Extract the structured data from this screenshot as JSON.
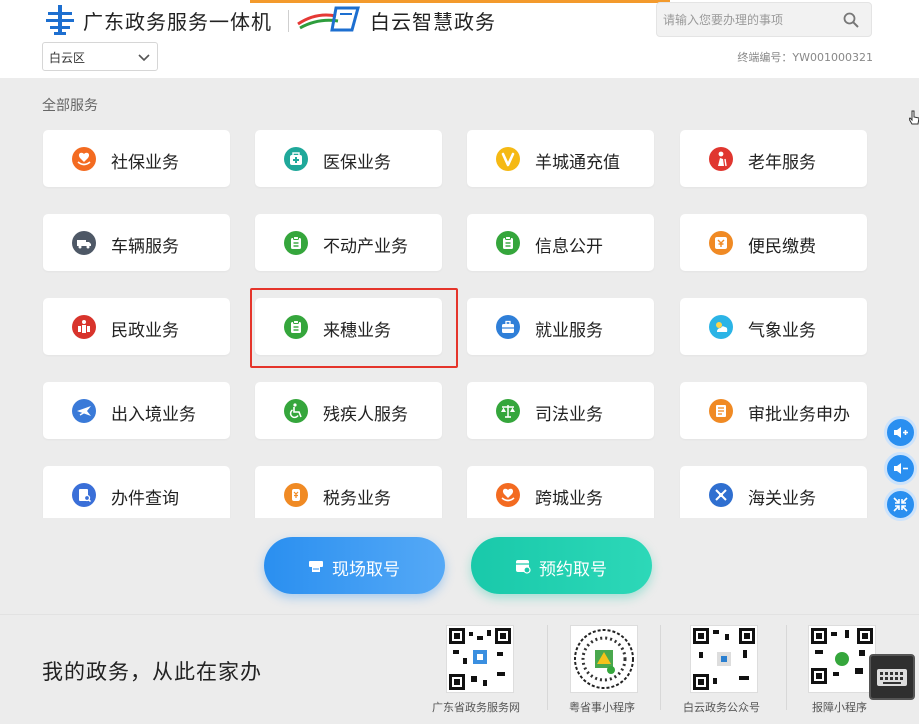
{
  "header": {
    "title_gd": "广东政务服务一体机",
    "title_by": "白云智慧政务",
    "search_placeholder": "请输入您要办理的事项",
    "district_value": "白云区",
    "terminal_id": "终端编号：YW001000321"
  },
  "main": {
    "section_title": "全部服务",
    "highlighted_tile": "来穗业务",
    "tiles": [
      {
        "label": "社保业务",
        "icon": "social-security-icon",
        "color": "#f36b21"
      },
      {
        "label": "医保业务",
        "icon": "medical-insurance-icon",
        "color": "#1fa89a"
      },
      {
        "label": "羊城通充值",
        "icon": "yct-topup-icon",
        "color": "#f5b914"
      },
      {
        "label": "老年服务",
        "icon": "elderly-service-icon",
        "color": "#e0362f"
      },
      {
        "label": "车辆服务",
        "icon": "vehicle-icon",
        "color": "#4e5866"
      },
      {
        "label": "不动产业务",
        "icon": "real-estate-icon",
        "color": "#35a63c"
      },
      {
        "label": "信息公开",
        "icon": "info-public-icon",
        "color": "#35a63c"
      },
      {
        "label": "便民缴费",
        "icon": "payment-icon",
        "color": "#f08a24"
      },
      {
        "label": "民政业务",
        "icon": "civil-affairs-icon",
        "color": "#d8342c"
      },
      {
        "label": "来穗业务",
        "icon": "migrant-affairs-icon",
        "color": "#35a63c"
      },
      {
        "label": "就业服务",
        "icon": "employment-icon",
        "color": "#2f7fd8"
      },
      {
        "label": "气象业务",
        "icon": "weather-icon",
        "color": "#2bb4e6"
      },
      {
        "label": "出入境业务",
        "icon": "immigration-icon",
        "color": "#3a7ad8"
      },
      {
        "label": "残疾人服务",
        "icon": "disability-icon",
        "color": "#35a63c"
      },
      {
        "label": "司法业务",
        "icon": "judicial-icon",
        "color": "#35a63c"
      },
      {
        "label": "审批业务申办",
        "icon": "approval-icon",
        "color": "#f08a24"
      },
      {
        "label": "办件查询",
        "icon": "case-query-icon",
        "color": "#3a6fd8"
      },
      {
        "label": "税务业务",
        "icon": "tax-icon",
        "color": "#f08a24"
      },
      {
        "label": "跨城业务",
        "icon": "cross-city-icon",
        "color": "#f36b21"
      },
      {
        "label": "海关业务",
        "icon": "customs-icon",
        "color": "#2f6fd0"
      }
    ],
    "onsite_button": "现场取号",
    "reserve_button": "预约取号"
  },
  "footer": {
    "slogan": "我的政务，从此在家办",
    "qr_codes": [
      {
        "label": "广东省政务服务网"
      },
      {
        "label": "粤省事小程序"
      },
      {
        "label": "白云政务公众号"
      },
      {
        "label": "报障小程序"
      }
    ]
  },
  "colors": {
    "accent_blue": "#2a8ff0",
    "accent_teal": "#19c9aa",
    "highlight_red": "#e5352b",
    "page_bg": "#ececec"
  }
}
